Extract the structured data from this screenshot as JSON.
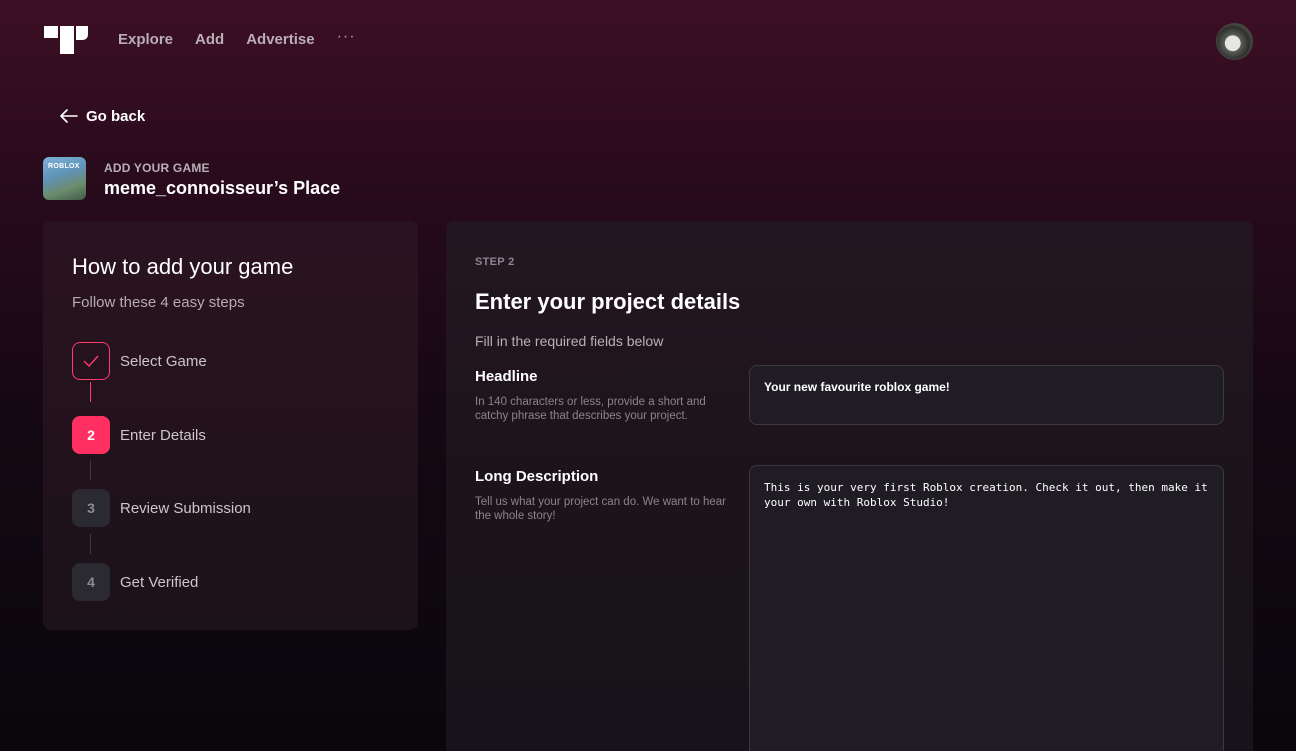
{
  "nav": {
    "logo_icon": "brand-logo-icon",
    "links": [
      "Explore",
      "Add",
      "Advertise"
    ],
    "more": "···"
  },
  "back": {
    "label": "Go back"
  },
  "game": {
    "kicker": "ADD YOUR GAME",
    "title": "meme_connoisseur’s Place",
    "thumb_text": "ROBLOX"
  },
  "steps_panel": {
    "title": "How to add your game",
    "subtitle": "Follow these 4 easy steps",
    "steps": [
      {
        "number": "✓",
        "label": "Select Game",
        "state": "done"
      },
      {
        "number": "2",
        "label": "Enter Details",
        "state": "active"
      },
      {
        "number": "3",
        "label": "Review Submission",
        "state": "pending"
      },
      {
        "number": "4",
        "label": "Get Verified",
        "state": "pending"
      }
    ]
  },
  "form": {
    "step_tag": "STEP 2",
    "title": "Enter your project details",
    "subtitle": "Fill in the required fields below",
    "headline": {
      "label": "Headline",
      "help": "In 140 characters or less, provide a short and catchy phrase that describes your project.",
      "value": "Your new favourite roblox game!"
    },
    "description": {
      "label": "Long Description",
      "help": "Tell us what your project can do. We want to hear the whole story!",
      "value": "This is your very first Roblox creation. Check it out, then make it your own with Roblox Studio!"
    }
  },
  "colors": {
    "accent": "#ff2f62",
    "panel": "#1f1c23"
  }
}
